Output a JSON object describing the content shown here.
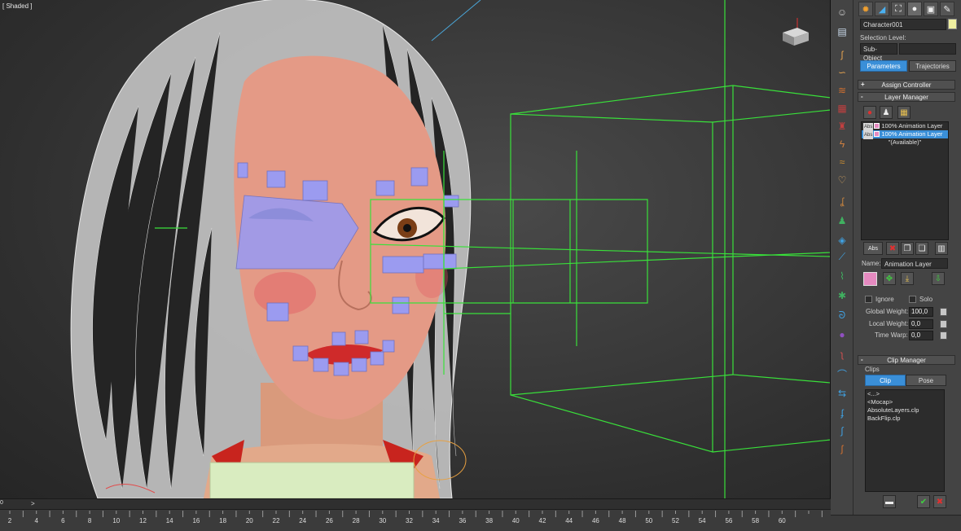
{
  "viewport": {
    "label": "[ Shaded ]"
  },
  "command_panel": {
    "tabs": [
      {
        "name": "create-tab-icon",
        "glyph": "✹"
      },
      {
        "name": "modify-tab-icon",
        "glyph": "◢"
      },
      {
        "name": "hierarchy-tab-icon",
        "glyph": "⛶"
      },
      {
        "name": "motion-tab-icon",
        "glyph": "●"
      },
      {
        "name": "display-tab-icon",
        "glyph": "▣"
      },
      {
        "name": "utilities-tab-icon",
        "glyph": "✎"
      }
    ],
    "object_name": "Character001",
    "selection_level_label": "Selection Level:",
    "sub_object": "Sub-Object",
    "parameters_button": "Parameters",
    "trajectories_button": "Trajectories",
    "assign_controller": "Assign Controller",
    "layer_manager": {
      "title": "Layer Manager",
      "layers": [
        {
          "tag": "Abs",
          "label": "100% Animation Layer",
          "selected": false
        },
        {
          "tag": "Abs",
          "label": "100% Animation Layer",
          "selected": true
        }
      ],
      "available": "\"(Available)\"",
      "name_label": "Name:",
      "name_value": "Animation Layer",
      "ignore_label": "Ignore",
      "solo_label": "Solo",
      "global_weight_label": "Global Weight:",
      "global_weight": "100,0",
      "local_weight_label": "Local Weight:",
      "local_weight": "0,0",
      "time_warp_label": "Time Warp:",
      "time_warp": "0,0",
      "abs_button": "Abs"
    },
    "clip_manager": {
      "title": "Clip Manager",
      "group_label": "Clips",
      "clip_button": "Clip",
      "pose_button": "Pose",
      "items": [
        "<...>",
        "<Mocap>",
        "AbsoluteLayers.clp",
        "BackFlip.clp"
      ]
    }
  },
  "timeline": {
    "slider_frame": "0",
    "slider_arrow": ">",
    "ticks": [
      "2",
      "4",
      "6",
      "8",
      "10",
      "12",
      "14",
      "16",
      "18",
      "20",
      "22",
      "24",
      "26",
      "28",
      "30",
      "32",
      "34",
      "36",
      "38",
      "40",
      "42",
      "44",
      "46",
      "48",
      "50",
      "52",
      "54",
      "56",
      "58",
      "60"
    ]
  },
  "colors": {
    "accent": "#3a8fd8",
    "wireframe": "#39e03a",
    "controls": "#9b9bf0",
    "layer_swatch": "#e58ac0"
  }
}
